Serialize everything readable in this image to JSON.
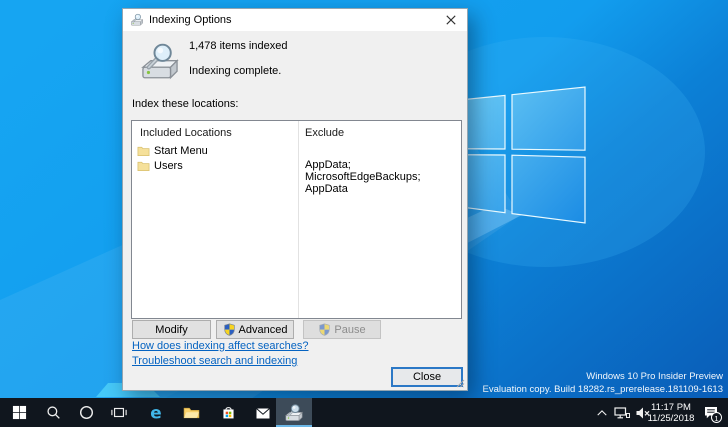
{
  "dialog": {
    "title": "Indexing Options",
    "items_indexed": "1,478 items indexed",
    "status": "Indexing complete.",
    "locations_label": "Index these locations:",
    "list": {
      "col1_header": "Included Locations",
      "col2_header": "Exclude",
      "rows": [
        {
          "name": "Start Menu",
          "exclude": ""
        },
        {
          "name": "Users",
          "exclude": "AppData; MicrosoftEdgeBackups; AppData"
        }
      ]
    },
    "buttons": {
      "modify": "Modify",
      "advanced": "Advanced",
      "pause": "Pause",
      "close": "Close"
    },
    "links": {
      "affect": "How does indexing affect searches?",
      "troubleshoot": "Troubleshoot search and indexing"
    }
  },
  "watermark": {
    "line1": "Windows 10 Pro Insider Preview",
    "line2": "Evaluation copy. Build 18282.rs_prerelease.181109-1613"
  },
  "taskbar": {
    "apps": [
      "start",
      "search",
      "cortana",
      "task-view",
      "edge",
      "file-explorer",
      "store",
      "mail",
      "indexing-options"
    ],
    "active_app": "indexing-options"
  },
  "icons": {
    "edge_glyph": "e"
  },
  "tray": {
    "time": "11:17 PM",
    "date": "11/25/2018",
    "notification_count": "1"
  },
  "colors": {
    "desktop_left_blue": "#13a1f0",
    "desktop_right_blue": "#0a60ba",
    "accent": "#0078d7",
    "link": "#0563c1",
    "taskbar": "#10161e"
  }
}
